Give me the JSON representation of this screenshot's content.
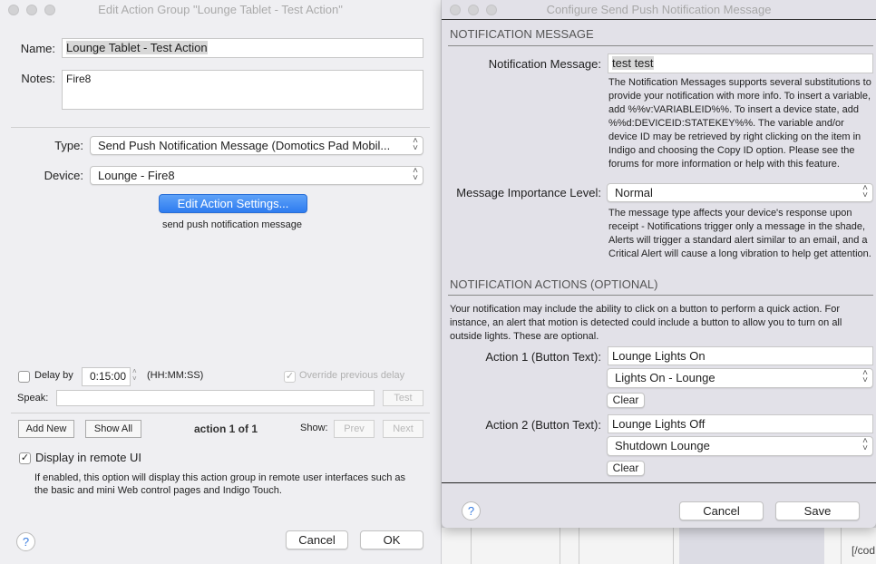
{
  "left": {
    "title": "Edit Action Group \"Lounge Tablet - Test Action\"",
    "name_label": "Name:",
    "name_value": "Lounge Tablet - Test Action",
    "notes_label": "Notes:",
    "notes_value": "Fire8",
    "type_label": "Type:",
    "type_value": "Send Push Notification Message (Domotics Pad Mobil...",
    "device_label": "Device:",
    "device_value": "Lounge - Fire8",
    "edit_settings": "Edit Action Settings...",
    "action_desc": "send push notification message",
    "delay_label": "Delay by",
    "delay_value": "0:15:00",
    "delay_format": "(HH:MM:SS)",
    "override_label": "Override previous delay",
    "speak_label": "Speak:",
    "speak_value": "",
    "test": "Test",
    "add_new": "Add New",
    "show_all": "Show All",
    "action_count": "action 1 of 1",
    "show_label": "Show:",
    "prev": "Prev",
    "next": "Next",
    "display_remote": "Display in remote UI",
    "display_remote_help": "If enabled, this option will display this action group in remote user interfaces such as the basic and mini Web control pages and Indigo Touch.",
    "help": "?",
    "cancel": "Cancel",
    "ok": "OK"
  },
  "right": {
    "title": "Configure Send Push Notification Message",
    "section1": "NOTIFICATION MESSAGE",
    "msg_label": "Notification Message:",
    "msg_value": "test test",
    "msg_help": "The Notification Messages supports several substitutions to provide your notification with more info. To insert a variable, add %%v:VARIABLEID%%. To insert a device state, add %%d:DEVICEID:STATEKEY%%. The variable and/or device ID may be retrieved by right clicking on the item in Indigo and choosing the Copy ID option. Please see the forums for more information or help with this feature.",
    "importance_label": "Message Importance Level:",
    "importance_value": "Normal",
    "importance_help": "The message type affects your device's response upon receipt - Notifications trigger only a message in the shade, Alerts will trigger a standard alert similar to an email, and a Critical Alert will cause a long vibration to help get attention.",
    "section2": "NOTIFICATION ACTIONS (OPTIONAL)",
    "section2_help": "Your notification may include the ability to click on a button to perform a quick action. For instance, an alert that motion is detected could include a button to allow you to turn on all outside lights. These are optional.",
    "action1_label": "Action 1 (Button Text):",
    "action1_text": "Lounge Lights On",
    "action1_select": "Lights On - Lounge",
    "clear": "Clear",
    "action2_label": "Action 2 (Button Text):",
    "action2_text": "Lounge Lights Off",
    "action2_select": "Shutdown Lounge",
    "help": "?",
    "cancel": "Cancel",
    "save": "Save"
  },
  "background": {
    "code_text": "[/cod"
  }
}
